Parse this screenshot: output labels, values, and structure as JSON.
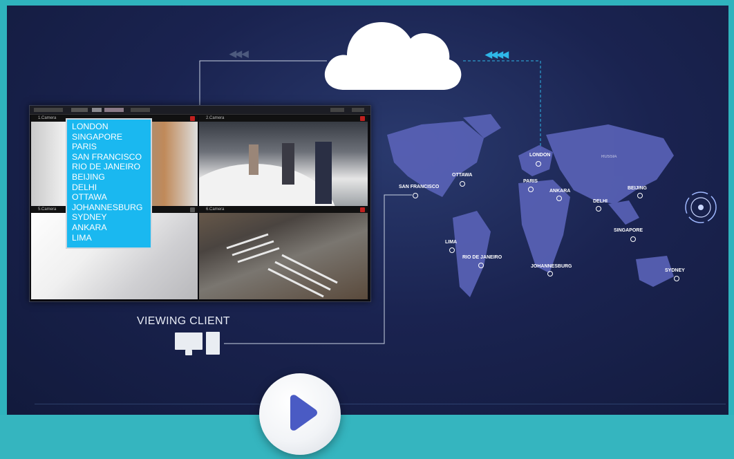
{
  "cloud": {
    "arrows_left": "◀◀ ◀",
    "arrows_right": "◀◀◀◀"
  },
  "viewer": {
    "cameras": [
      {
        "label": "1.Camera"
      },
      {
        "label": "2.Camera"
      },
      {
        "label": "5.Camera"
      },
      {
        "label": "6.Camera"
      }
    ]
  },
  "city_list": [
    "LONDON",
    "SINGAPORE",
    "PARIS",
    "SAN FRANCISCO",
    "RIO DE JANEIRO",
    "BEIJING",
    "DELHI",
    "OTTAWA",
    "JOHANNESBURG",
    "SYDNEY",
    "ANKARA",
    "LIMA"
  ],
  "viewing_client": {
    "label": "VIEWING CLIENT"
  },
  "map": {
    "cities": [
      {
        "name": "LONDON"
      },
      {
        "name": "OTTAWA"
      },
      {
        "name": "SAN FRANCISCO"
      },
      {
        "name": "PARIS"
      },
      {
        "name": "ANKARA"
      },
      {
        "name": "BEIJING"
      },
      {
        "name": "DELHI"
      },
      {
        "name": "SINGAPORE"
      },
      {
        "name": "LIMA"
      },
      {
        "name": "RIO DE JANEIRO"
      },
      {
        "name": "JOHANNESBURG"
      },
      {
        "name": "SYDNEY"
      },
      {
        "name": "RUSSIA"
      }
    ]
  },
  "colors": {
    "accent_blue": "#1ab8f0",
    "teal_band": "#35b5bf",
    "background": "#1a2350",
    "play_triangle": "#4a5bc4"
  },
  "icons": [
    "cloud-icon",
    "play-icon",
    "target-icon",
    "monitor-icon",
    "tablet-icon"
  ]
}
